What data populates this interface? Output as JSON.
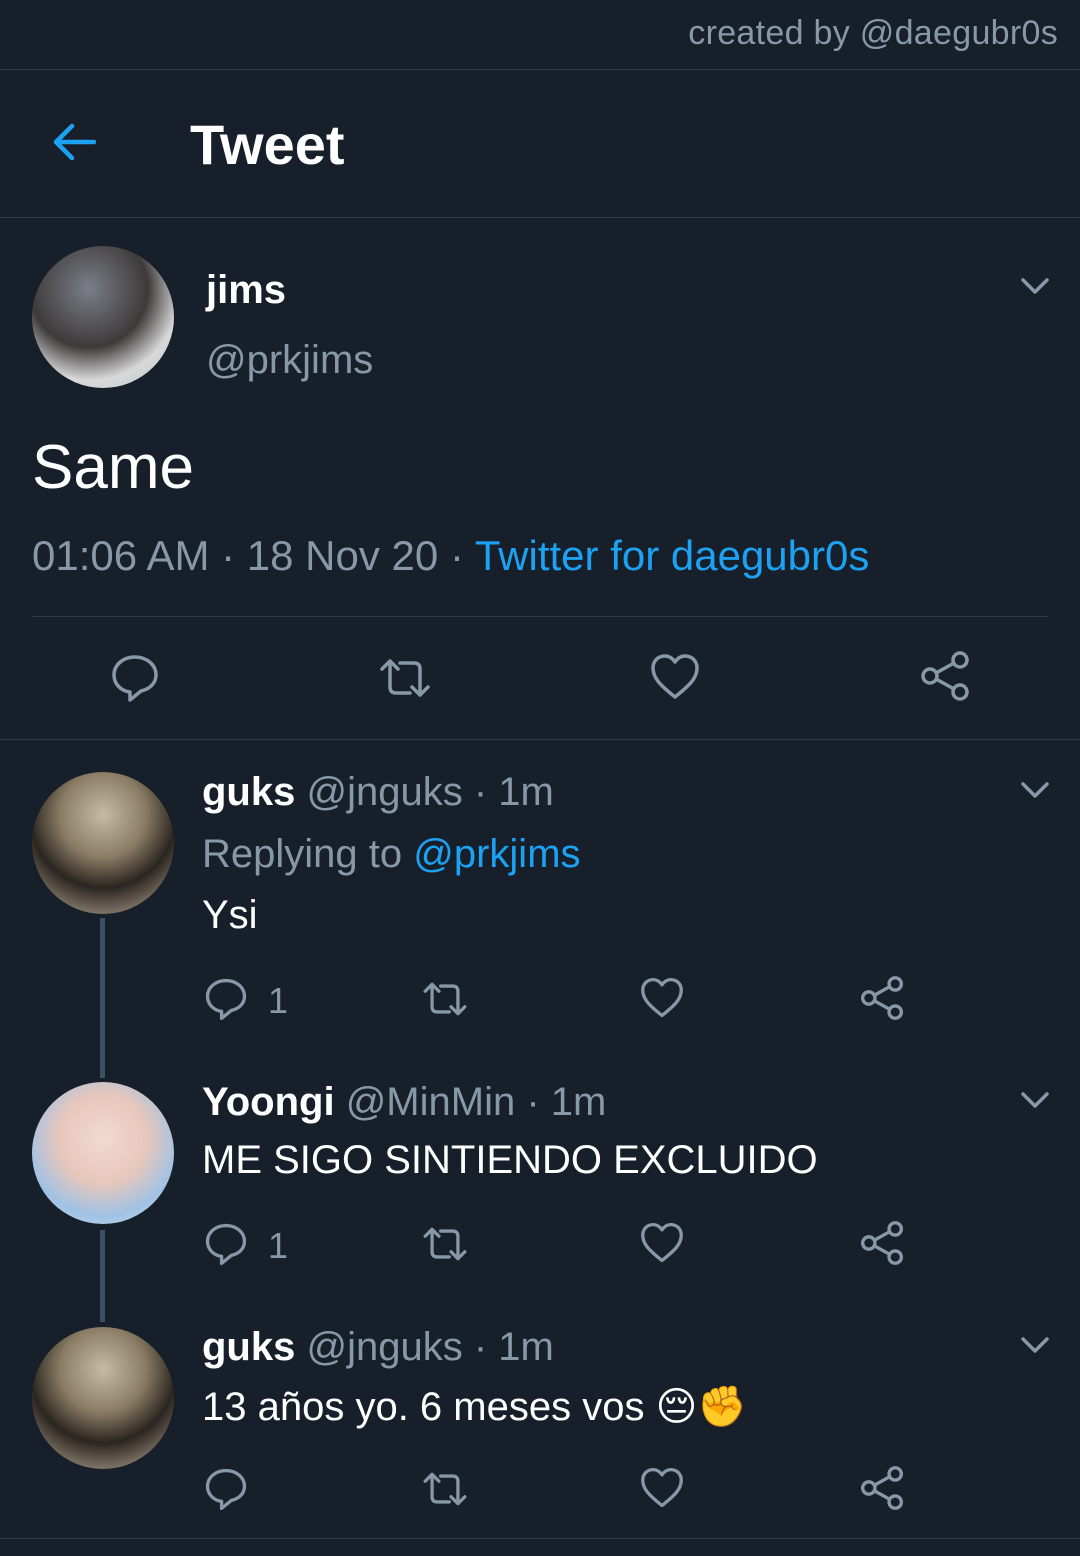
{
  "credit": "created by @daegubr0s",
  "header": {
    "title": "Tweet"
  },
  "tweet": {
    "name": "jims",
    "handle": "@prkjims",
    "text": "Same",
    "time": "01:06 AM",
    "date": "18 Nov 20",
    "source": "Twitter for daegubr0s"
  },
  "replies": [
    {
      "name": "guks",
      "handle": "@jnguks",
      "age": "1m",
      "replying_label": "Replying to",
      "replying_to": "@prkjims",
      "text": "Ysi",
      "reply_count": "1"
    },
    {
      "name": "Yoongi",
      "handle": "@MinMin",
      "age": "1m",
      "text": "ME SIGO SINTIENDO EXCLUIDO",
      "reply_count": "1"
    },
    {
      "name": "guks",
      "handle": "@jnguks",
      "age": "1m",
      "text": "13 años yo. 6 meses vos 😔✊",
      "reply_count": ""
    }
  ],
  "colors": {
    "background": "#161f2a",
    "accent": "#1da1f2",
    "muted": "#8899a6",
    "divider": "#2d3a47"
  },
  "icons": [
    "back-arrow-icon",
    "chevron-down-icon",
    "reply-icon",
    "retweet-icon",
    "like-icon",
    "share-icon"
  ]
}
